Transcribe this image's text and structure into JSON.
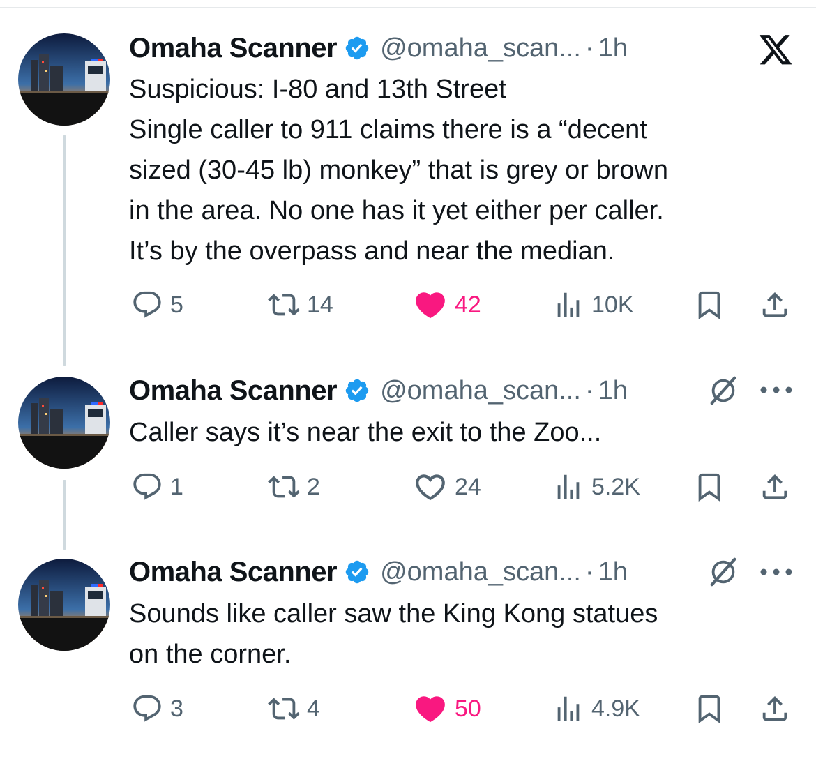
{
  "tweets": [
    {
      "name": "Omaha Scanner",
      "handle": "@omaha_scan...",
      "separator": "·",
      "time": "1h",
      "lines": [
        "Suspicious: I-80 and 13th Street",
        "Single caller to 911 claims there is a “decent",
        "sized (30-45 lb) monkey” that is grey or brown",
        "in the area. No one has it yet either per caller.",
        "It’s by the overpass and near the median."
      ],
      "replies": "5",
      "reposts": "14",
      "likes": "42",
      "liked": true,
      "views": "10K",
      "top_right_icon": "x-logo-icon"
    },
    {
      "name": "Omaha Scanner",
      "handle": "@omaha_scan...",
      "separator": "·",
      "time": "1h",
      "lines": [
        "Caller says it’s near the exit to the Zoo..."
      ],
      "replies": "1",
      "reposts": "2",
      "likes": "24",
      "liked": false,
      "views": "5.2K",
      "top_right_icon": "grok-icon"
    },
    {
      "name": "Omaha Scanner",
      "handle": "@omaha_scan...",
      "separator": "·",
      "time": "1h",
      "lines": [
        "Sounds like caller saw the King Kong statues",
        "on the corner."
      ],
      "replies": "3",
      "reposts": "4",
      "likes": "50",
      "liked": true,
      "views": "4.9K",
      "top_right_icon": "grok-icon"
    }
  ],
  "colors": {
    "text": "#0f1419",
    "secondary": "#536471",
    "like": "#f91880",
    "verified": "#1d9bf0",
    "thread_line": "#cfd9de"
  }
}
